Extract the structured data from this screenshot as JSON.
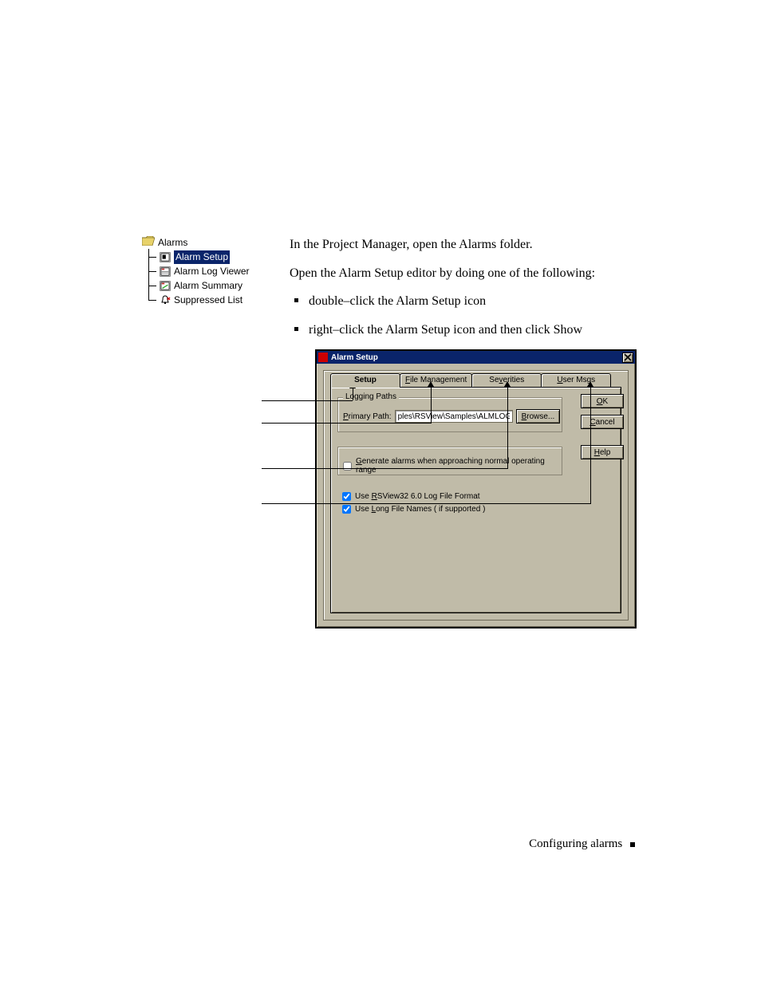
{
  "tree": {
    "root": "Alarms",
    "items": [
      "Alarm Setup",
      "Alarm Log Viewer",
      "Alarm Summary",
      "Suppressed List"
    ],
    "selected_index": 0
  },
  "body": {
    "p1": "In the Project Manager, open the Alarms folder.",
    "p2": "Open the Alarm Setup editor by doing one of the following:",
    "b1": "double–click the Alarm Setup icon",
    "b2": "right–click the Alarm Setup icon and then click Show"
  },
  "dialog": {
    "title": "Alarm Setup",
    "close": "×",
    "tabs": {
      "setup": "Setup",
      "filemgmt": {
        "text": "File Management",
        "ul_index": 0
      },
      "severities": {
        "text": "Severities",
        "ul_index": 2
      },
      "usermsgs": {
        "text": "User Msgs",
        "ul_index": 0
      }
    },
    "group_logging": {
      "legend": "Logging Paths",
      "primary_label": {
        "text": "Primary Path:",
        "ul_index": 0
      },
      "primary_value": "ples\\RSView\\Samples\\ALMLOG\\",
      "browse": {
        "text": "Browse...",
        "ul_index": 0
      }
    },
    "chk_generate": {
      "text": "Generate alarms when approaching normal operating range",
      "ul_index": 0,
      "checked": false
    },
    "chk_rsview": {
      "text": "Use RSView32 6.0 Log File Format",
      "ul_index": 4,
      "checked": true
    },
    "chk_longnames": {
      "text": "Use Long File Names ( if supported )",
      "ul_index": 4,
      "checked": true
    },
    "buttons": {
      "ok": {
        "text": "OK",
        "ul_index": 0
      },
      "cancel": {
        "text": "Cancel",
        "ul_index": 0
      },
      "help": {
        "text": "Help",
        "ul_index": 0
      }
    }
  },
  "footer": {
    "text": "Configuring alarms"
  }
}
